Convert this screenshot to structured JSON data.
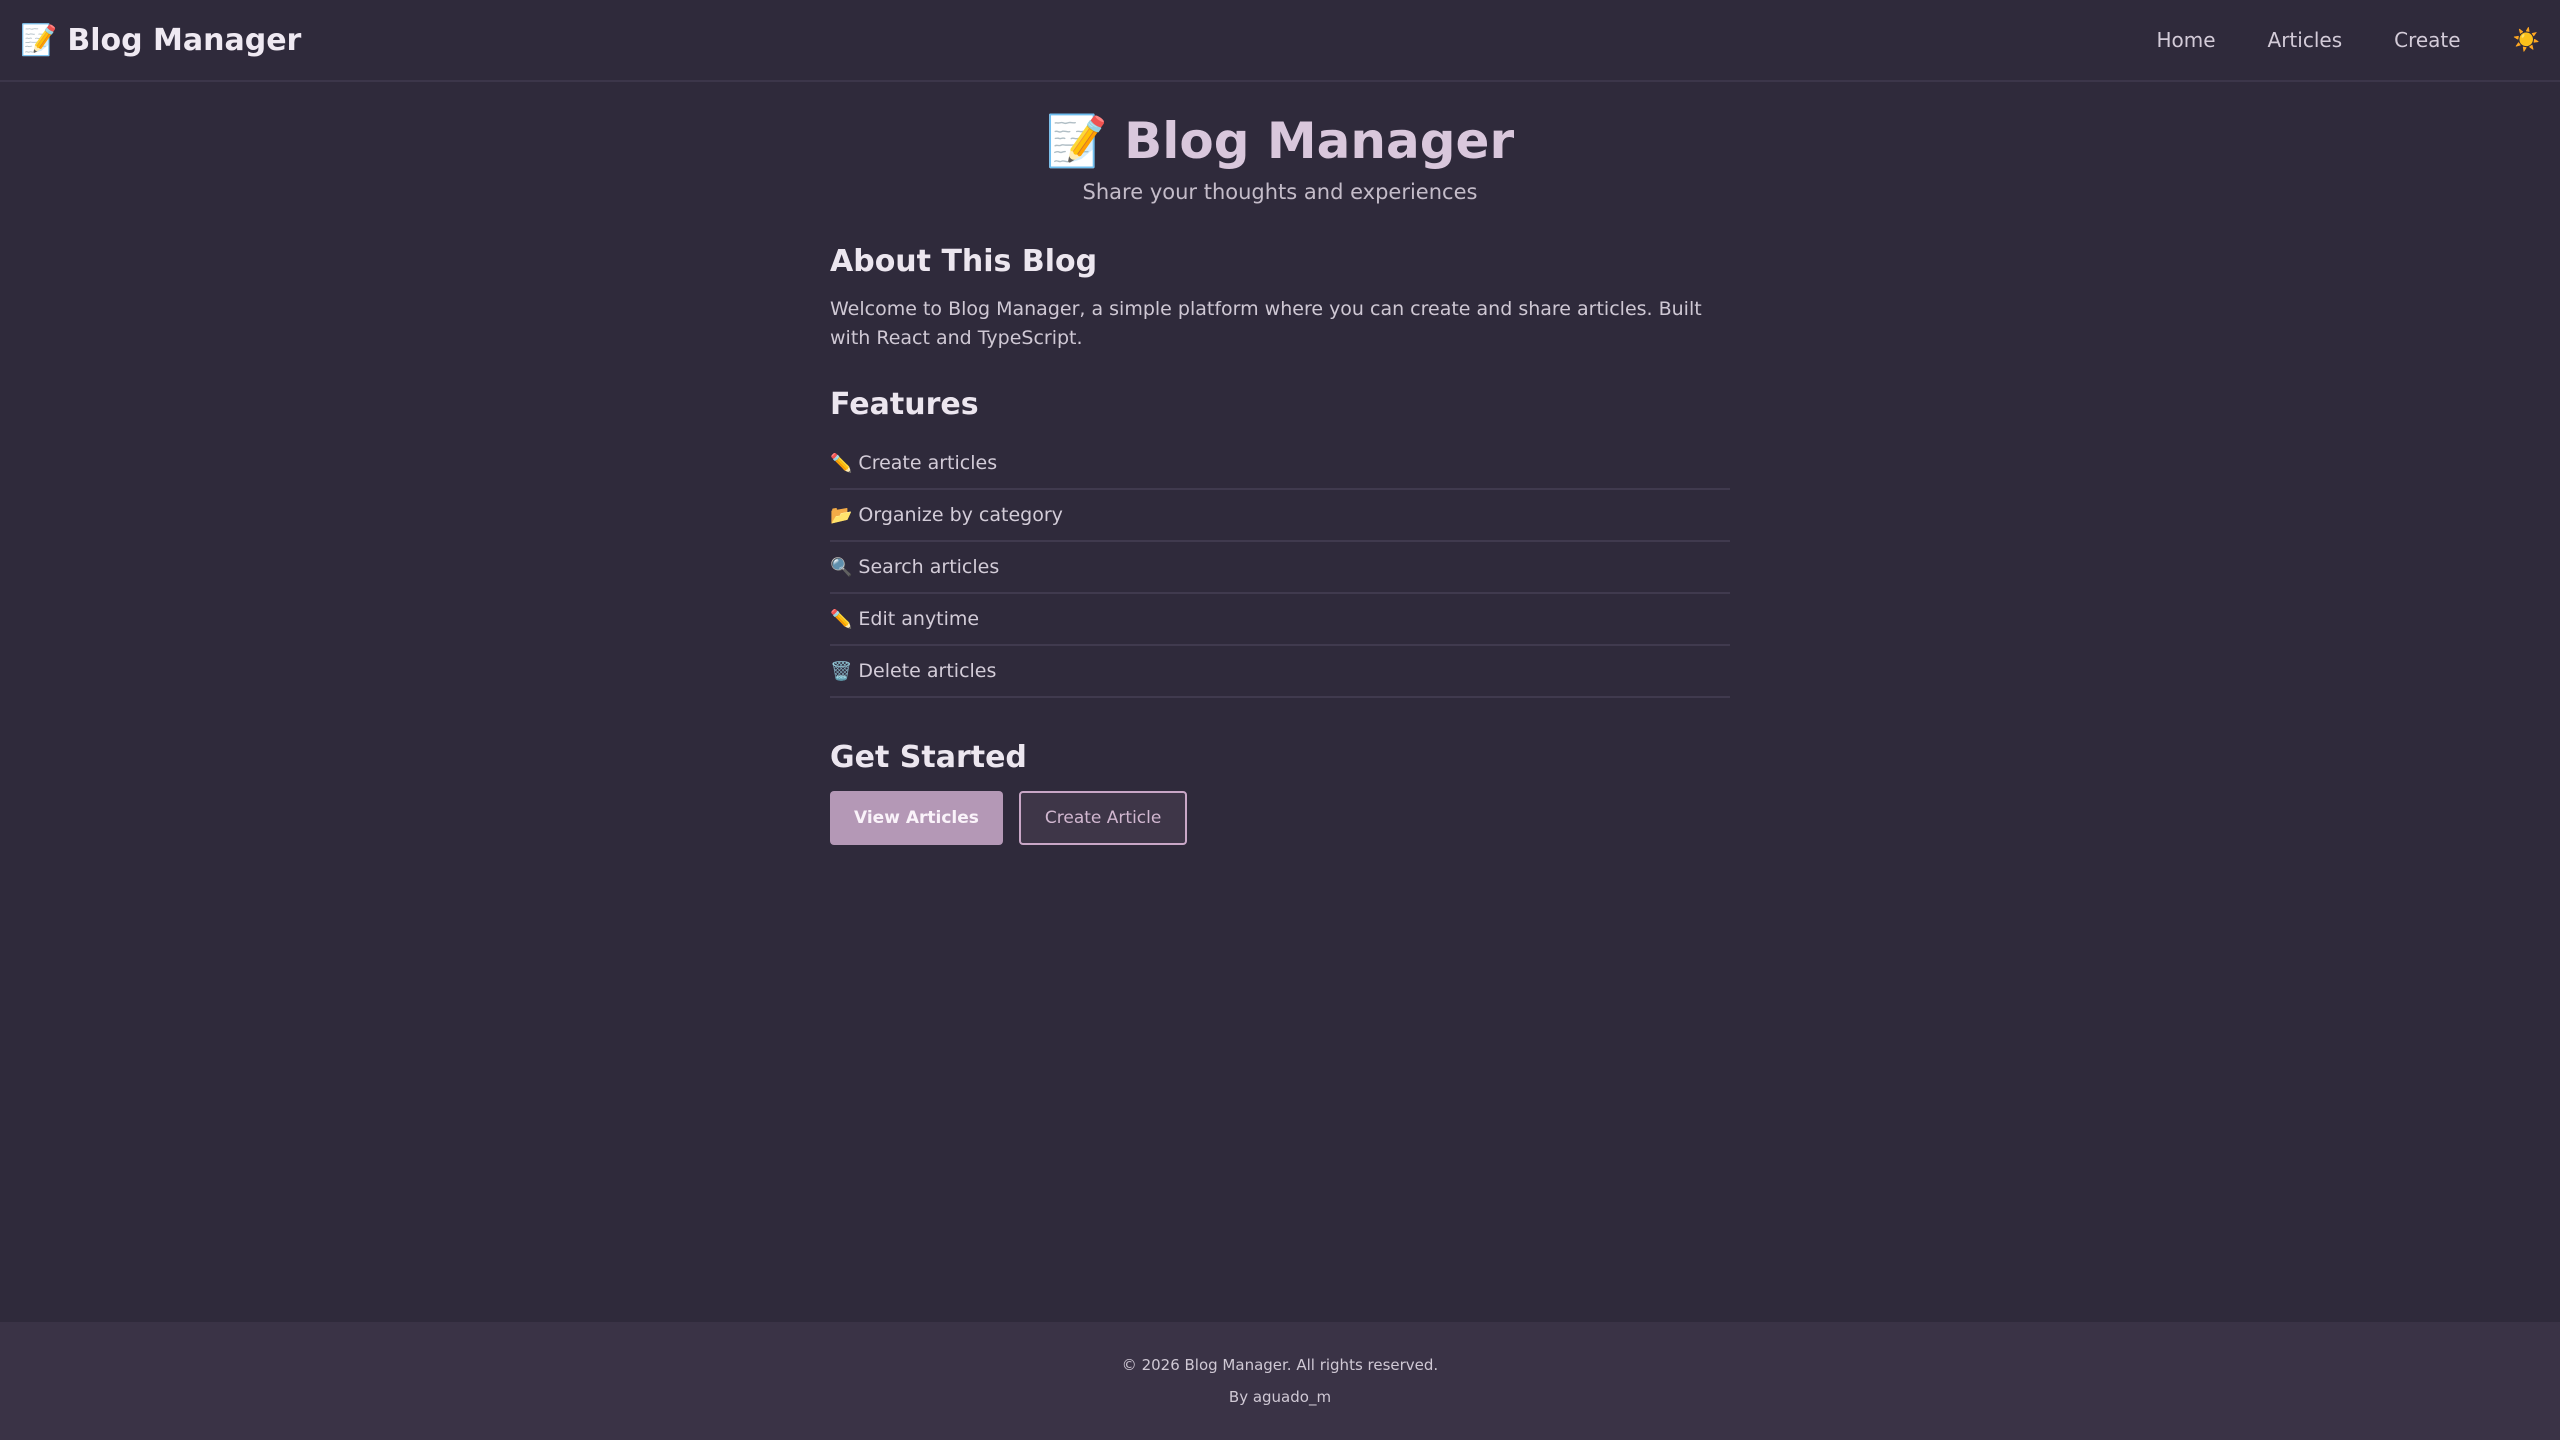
{
  "header": {
    "brand_icon": "📝",
    "brand_title": "Blog Manager",
    "nav": [
      {
        "label": "Home"
      },
      {
        "label": "Articles"
      },
      {
        "label": "Create"
      }
    ],
    "theme_toggle_icon": "☀️"
  },
  "hero": {
    "icon": "📝",
    "title": "Blog Manager",
    "subtitle": "Share your thoughts and experiences"
  },
  "about": {
    "title": "About This Blog",
    "text": "Welcome to Blog Manager, a simple platform where you can create and share articles. Built with React and TypeScript."
  },
  "features": {
    "title": "Features",
    "items": [
      {
        "icon": "✏️",
        "icon_name": "pencil-icon",
        "label": "Create articles"
      },
      {
        "icon": "📂",
        "icon_name": "folder-icon",
        "label": "Organize by category"
      },
      {
        "icon": "🔍",
        "icon_name": "search-icon",
        "label": "Search articles"
      },
      {
        "icon": "✏️",
        "icon_name": "pencil-icon",
        "label": "Edit anytime"
      },
      {
        "icon": "🗑️",
        "icon_name": "trash-icon",
        "label": "Delete articles"
      }
    ]
  },
  "get_started": {
    "title": "Get Started",
    "primary_label": "View Articles",
    "secondary_label": "Create Article"
  },
  "footer": {
    "copyright": "© 2026 Blog Manager. All rights reserved.",
    "author": "By aguado_m"
  },
  "colors": {
    "background": "#2f2a3b",
    "footer_background": "#3a3346",
    "accent": "#b498b6",
    "hero_title": "#d9c7dc"
  }
}
